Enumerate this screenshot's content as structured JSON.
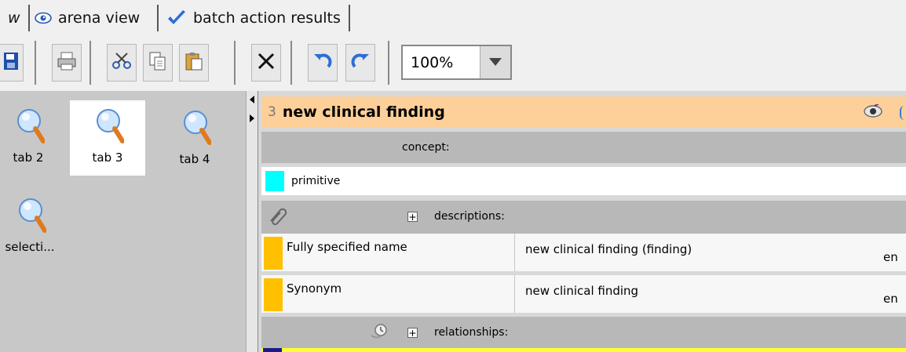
{
  "tabs": [
    {
      "label": "w",
      "icon": "none"
    },
    {
      "label": "arena view",
      "icon": "eye-icon"
    },
    {
      "label": "batch action results",
      "icon": "checkmark-icon"
    }
  ],
  "toolbar": {
    "buttons": [
      "save-icon",
      "print-icon",
      "cut-icon",
      "copy-icon",
      "paste-icon",
      "delete-icon",
      "undo-icon",
      "redo-icon"
    ],
    "zoom_value": "100%"
  },
  "left_panel": {
    "items": [
      {
        "label": "tab 2",
        "selected": false
      },
      {
        "label": "tab 3",
        "selected": true
      },
      {
        "label": "tab 4",
        "selected": false
      },
      {
        "label": "selecti...",
        "selected": false
      }
    ]
  },
  "concept": {
    "number": "3",
    "title": "new clinical finding",
    "concept_label": "concept:",
    "status": "primitive",
    "descriptions_label": "descriptions:",
    "descriptions": [
      {
        "type": "Fully specified name",
        "term": "new clinical finding (finding)",
        "lang": "en"
      },
      {
        "type": "Synonym",
        "term": "new clinical finding",
        "lang": "en"
      }
    ],
    "relationships_label": "relationships:"
  },
  "colors": {
    "header": "#fdd09a",
    "primitive_swatch": "#00ffff",
    "description_swatch": "#ffc000",
    "relationship_row": "#ffff33"
  }
}
